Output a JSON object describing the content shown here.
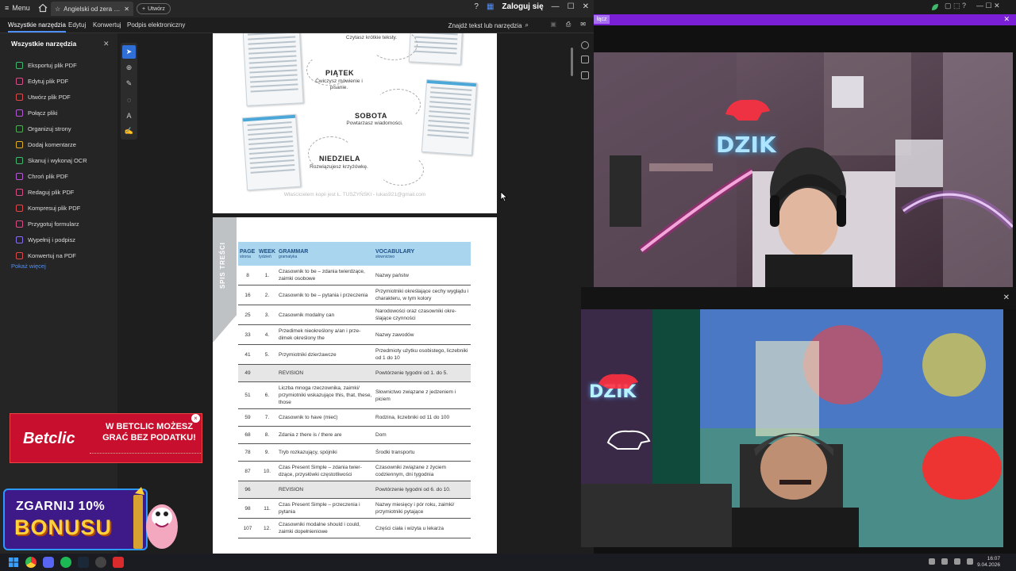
{
  "titlebar": {
    "menu": "Menu",
    "tab_title": "Angielski od zera w ...",
    "new_tab": "Utwórz",
    "login": "Zaloguj się"
  },
  "menubar": {
    "items": [
      "Wszystkie narzędzia",
      "Edytuj",
      "Konwertuj",
      "Podpis elektroniczny"
    ],
    "find": "Znajdź tekst lub narzędzia"
  },
  "sidebar": {
    "title": "Wszystkie narzędzia",
    "items": [
      {
        "label": "Eksportuj plik PDF",
        "color": "#3fb96c"
      },
      {
        "label": "Edytuj plik PDF",
        "color": "#d94c8a"
      },
      {
        "label": "Utwórz plik PDF",
        "color": "#e04848"
      },
      {
        "label": "Połącz pliki",
        "color": "#b458d6"
      },
      {
        "label": "Organizuj strony",
        "color": "#4caf50"
      },
      {
        "label": "Dodaj komentarze",
        "color": "#e0b020"
      },
      {
        "label": "Skanuj i wykonaj OCR",
        "color": "#3fb96c"
      },
      {
        "label": "Chroń plik PDF",
        "color": "#b458d6"
      },
      {
        "label": "Redaguj plik PDF",
        "color": "#d94c8a"
      },
      {
        "label": "Kompresuj plik PDF",
        "color": "#e04848"
      },
      {
        "label": "Przygotuj formularz",
        "color": "#d94c8a"
      },
      {
        "label": "Wypełnij i podpisz",
        "color": "#8b6cf0"
      },
      {
        "label": "Konwertuj na PDF",
        "color": "#e04848"
      }
    ],
    "more": "Pokaż więcej"
  },
  "page1": {
    "top_caption": "Czytasz krótkie teksty.",
    "days": [
      {
        "day": "PIĄTEK",
        "desc": "Ćwiczysz mówienie i pisanie."
      },
      {
        "day": "SOBOTA",
        "desc": "Powtarzasz wiadomości."
      },
      {
        "day": "NIEDZIELA",
        "desc": "Rozwiązujesz krzyżówkę."
      }
    ],
    "watermark": "Właścicielem kopii jest Ł. TUSZYŃSKI - lukas921@gmail.com"
  },
  "page2": {
    "side_tab": "SPIS TREŚCI",
    "headers": [
      {
        "h": "PAGE",
        "s": "strona"
      },
      {
        "h": "WEEK",
        "s": "tydzień"
      },
      {
        "h": "GRAMMAR",
        "s": "gramatyka"
      },
      {
        "h": "VOCABULARY",
        "s": "słownictwo"
      }
    ],
    "rows": [
      {
        "page": "8",
        "week": "1.",
        "grammar": "Czasownik to be – zdania twier­dzące, zaimki osobowe",
        "vocab": "Nazwy państw",
        "rev": false
      },
      {
        "page": "16",
        "week": "2.",
        "grammar": "Czasownik to be – pytania i przecze­nia",
        "vocab": "Przymiotniki określające cechy wyglądu i charakteru, w tym kolory",
        "rev": false
      },
      {
        "page": "25",
        "week": "3.",
        "grammar": "Czasownik modalny can",
        "vocab": "Narodowości oraz czasowniki okre­ślające czynności",
        "rev": false
      },
      {
        "page": "33",
        "week": "4.",
        "grammar": "Przedimek nieokreślony a/an i prze­dimek określony the",
        "vocab": "Nazwy zawodów",
        "rev": false
      },
      {
        "page": "41",
        "week": "5.",
        "grammar": "Przymiotniki dzierżawcze",
        "vocab": "Przedmioty użytku osobistego, liczebniki od 1 do 10",
        "rev": false
      },
      {
        "page": "49",
        "week": "",
        "grammar": "REVISION",
        "vocab": "Powtórzenie tygodni od 1. do 5.",
        "rev": true
      },
      {
        "page": "51",
        "week": "6.",
        "grammar": "Liczba mnoga rzeczownika, zaimki/ przymiotniki wskazujące this, that, these, those",
        "vocab": "Słownictwo związane z jedzeniem i piciem",
        "rev": false
      },
      {
        "page": "59",
        "week": "7.",
        "grammar": "Czasownik to have (mieć)",
        "vocab": "Rodzina, liczebniki od 11 do 100",
        "rev": false
      },
      {
        "page": "68",
        "week": "8.",
        "grammar": "Zdania z there is / there are",
        "vocab": "Dom",
        "rev": false
      },
      {
        "page": "78",
        "week": "9.",
        "grammar": "Tryb rozkazujący, spójniki",
        "vocab": "Środki transportu",
        "rev": false
      },
      {
        "page": "87",
        "week": "10.",
        "grammar": "Czas Present Simple – zdania twier­dzące, przysłówki częstotliwości",
        "vocab": "Czasowniki związane z życiem codziennym, dni tygodnia",
        "rev": false
      },
      {
        "page": "96",
        "week": "",
        "grammar": "REVISION",
        "vocab": "Powtórzenie tygodni od 6. do 10.",
        "rev": true
      },
      {
        "page": "98",
        "week": "11.",
        "grammar": "Czas Present Simple – przeczenia i pytania",
        "vocab": "Nazwy miesięcy i pór roku, zaimki/ przymiotniki pytające",
        "rev": false
      },
      {
        "page": "107",
        "week": "12.",
        "grammar": "Czasowniki modalne should i could, zaimki dopełnieniowe",
        "vocab": "Części ciała i wizyta u lekarza",
        "rev": false
      }
    ]
  },
  "ads": {
    "betclic_logo": "Betclic",
    "betclic_text": "W BETCLIC MOŻESZ GRAĆ BEZ PODATKU!",
    "bonus_line1": "ZGARNIJ 10%",
    "bonus_line2": "BONUSU"
  },
  "stream": {
    "top_button": "łącz",
    "logo_top": "DZIK",
    "logo_bottom": "DZIK"
  },
  "taskbar": {
    "time": "16:07",
    "date": "9.04.2026"
  }
}
